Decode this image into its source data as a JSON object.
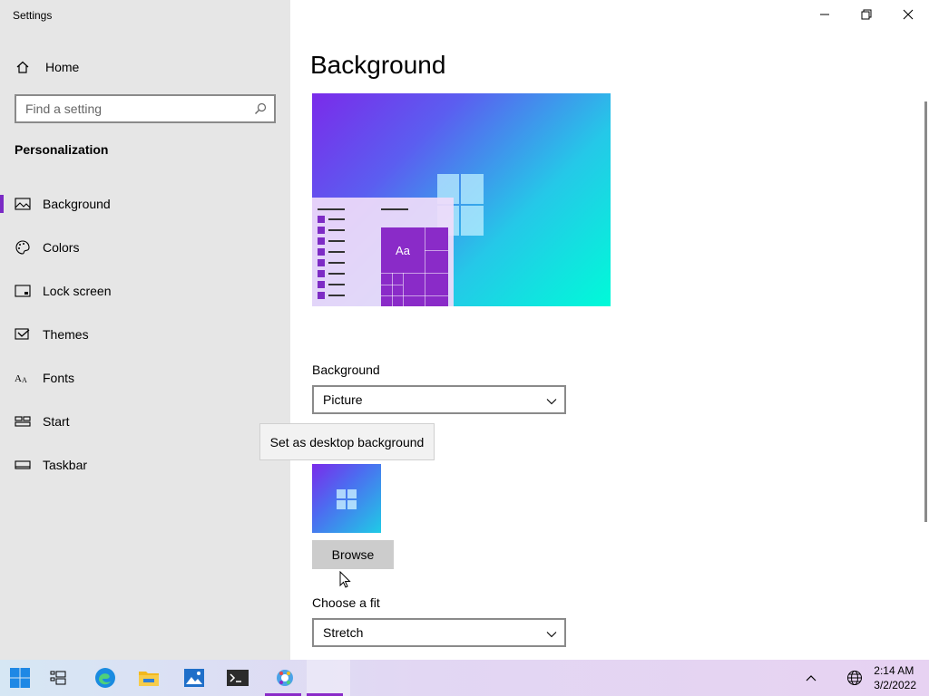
{
  "window": {
    "title": "Settings",
    "minimize_icon": "minimize-icon",
    "maximize_icon": "restore-icon",
    "close_icon": "close-icon"
  },
  "sidebar": {
    "home_label": "Home",
    "search_placeholder": "Find a setting",
    "section_title": "Personalization",
    "items": [
      {
        "label": "Background",
        "icon": "picture-icon",
        "active": true
      },
      {
        "label": "Colors",
        "icon": "palette-icon",
        "active": false
      },
      {
        "label": "Lock screen",
        "icon": "lock-screen-icon",
        "active": false
      },
      {
        "label": "Themes",
        "icon": "themes-icon",
        "active": false
      },
      {
        "label": "Fonts",
        "icon": "fonts-icon",
        "active": false
      },
      {
        "label": "Start",
        "icon": "start-icon",
        "active": false
      },
      {
        "label": "Taskbar",
        "icon": "taskbar-icon",
        "active": false
      }
    ],
    "accent_color": "#7b2bc5"
  },
  "main": {
    "page_title": "Background",
    "preview_sample_text": "Aa",
    "background_label": "Background",
    "background_value": "Picture",
    "tooltip": "Set as desktop background",
    "browse_label": "Browse",
    "fit_label": "Choose a fit",
    "fit_value": "Stretch"
  },
  "taskbar": {
    "icons": [
      "windows-start-icon",
      "task-view-icon",
      "edge-icon",
      "file-explorer-icon",
      "photos-icon",
      "terminal-icon",
      "settings-icon"
    ],
    "time": "2:14 AM",
    "date": "3/2/2022"
  }
}
